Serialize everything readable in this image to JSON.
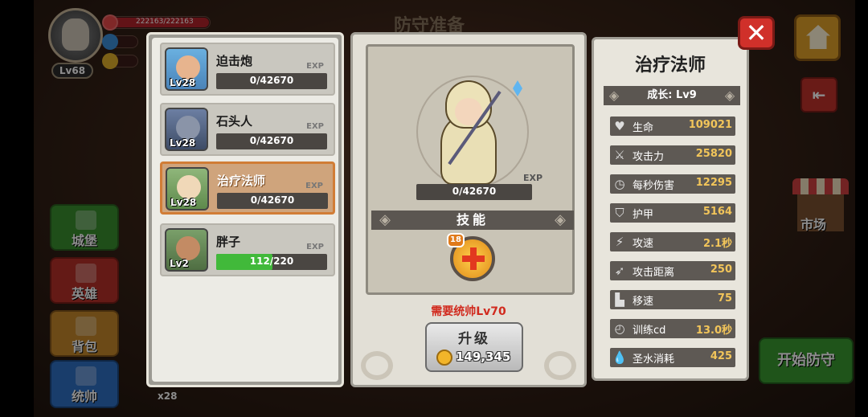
{
  "player": {
    "level": "Lv68",
    "hp": "222163/222163"
  },
  "screen_title": "防守准备",
  "nav": {
    "city": "城堡",
    "hero": "英雄",
    "bag": "背包",
    "commander": "统帅",
    "item_count": "x28"
  },
  "right": {
    "market": "市场",
    "start_defense": "开始防守",
    "exit_icon": "exit-door-icon"
  },
  "heroes": [
    {
      "name": "迫击炮",
      "level": "Lv28",
      "exp": "0/42670",
      "exp_fraction": 0
    },
    {
      "name": "石头人",
      "level": "Lv28",
      "exp": "0/42670",
      "exp_fraction": 0
    },
    {
      "name": "治疗法师",
      "level": "Lv28",
      "exp": "0/42670",
      "exp_fraction": 0,
      "selected": true
    },
    {
      "name": "胖子",
      "level": "Lv2",
      "exp": "112/220",
      "exp_fraction": 0.509
    }
  ],
  "exp_label": "EXP",
  "detail": {
    "exp": "0/42670",
    "skills_title": "技能",
    "skill_level": "18",
    "requirement_prefix": "需要统帅",
    "requirement_level": "Lv70",
    "upgrade_label": "升级",
    "upgrade_cost": "149,345"
  },
  "stats": {
    "name": "治疗法师",
    "growth": "成长: Lv9",
    "rows": [
      {
        "icon": "heart-icon",
        "label": "生命",
        "value": "109021"
      },
      {
        "icon": "sword-icon",
        "label": "攻击力",
        "value": "25820"
      },
      {
        "icon": "timer-sword-icon",
        "label": "每秒伤害",
        "value": "12295"
      },
      {
        "icon": "shield-icon",
        "label": "护甲",
        "value": "5164"
      },
      {
        "icon": "lightning-icon",
        "label": "攻速",
        "value": "2.1秒"
      },
      {
        "icon": "bow-icon",
        "label": "攻击距离",
        "value": "250"
      },
      {
        "icon": "boot-icon",
        "label": "移速",
        "value": "75"
      },
      {
        "icon": "clock-icon",
        "label": "训练cd",
        "value": "13.0秒"
      },
      {
        "icon": "water-drop-icon",
        "label": "圣水消耗",
        "value": "425"
      }
    ]
  }
}
